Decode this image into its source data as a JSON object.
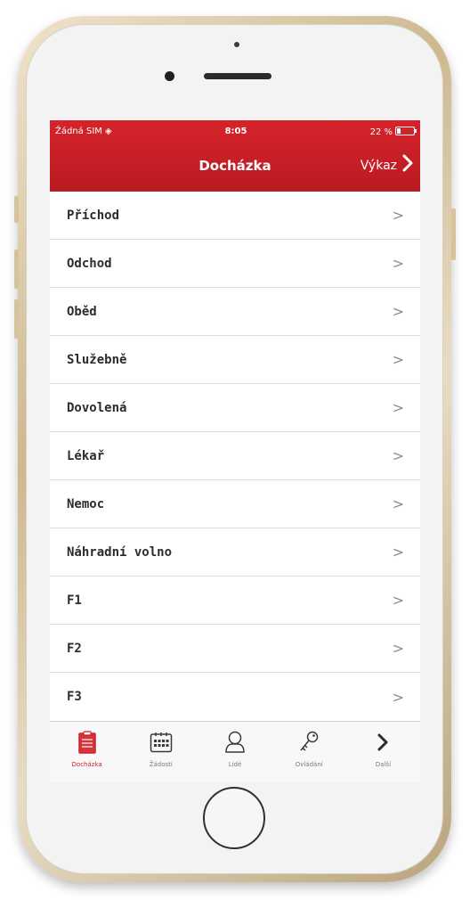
{
  "status_bar": {
    "carrier": "Žádná SIM",
    "time": "8:05",
    "battery": "22 %"
  },
  "nav": {
    "title": "Docházka",
    "right_label": "Výkaz"
  },
  "list": {
    "items": [
      {
        "label": "Příchod"
      },
      {
        "label": "Odchod"
      },
      {
        "label": "Oběd"
      },
      {
        "label": "Služebně"
      },
      {
        "label": "Dovolená"
      },
      {
        "label": "Lékař"
      },
      {
        "label": "Nemoc"
      },
      {
        "label": "Náhradní volno"
      },
      {
        "label": "F1"
      },
      {
        "label": "F2"
      },
      {
        "label": "F3"
      }
    ],
    "chevron": ">"
  },
  "tabbar": {
    "tabs": [
      {
        "label": "Docházka",
        "icon": "clipboard-icon",
        "active": true
      },
      {
        "label": "Žádosti",
        "icon": "calendar-icon",
        "active": false
      },
      {
        "label": "Lidé",
        "icon": "person-icon",
        "active": false
      },
      {
        "label": "Ovládání",
        "icon": "key-icon",
        "active": false
      },
      {
        "label": "Další",
        "icon": "chevron-right-icon",
        "active": false
      }
    ]
  },
  "colors": {
    "accent": "#c8242b",
    "header_bg": "#c8242b",
    "tab_inactive": "#7b7b7b"
  }
}
